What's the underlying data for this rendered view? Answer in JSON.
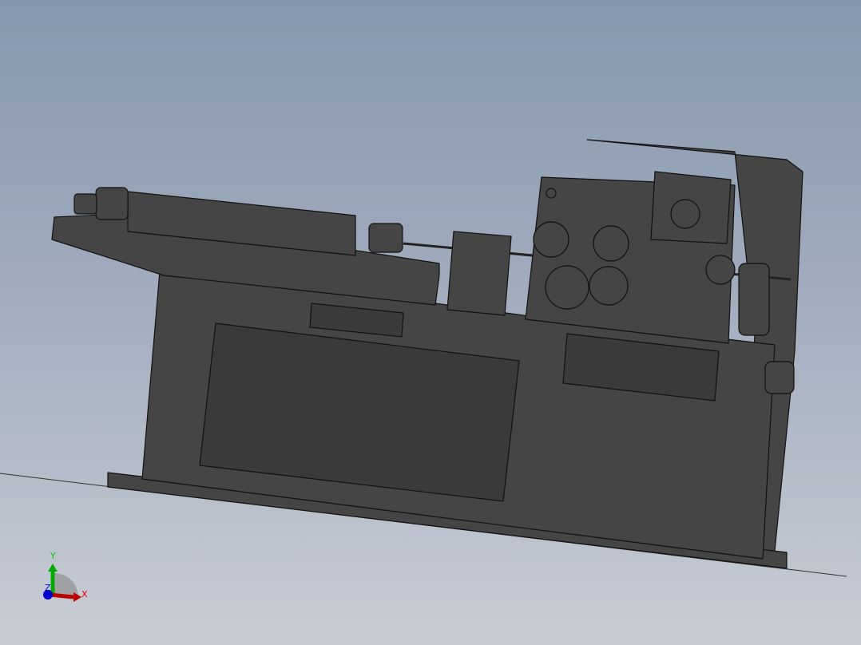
{
  "viewport": {
    "title": "",
    "background_top": "#8697ad",
    "background_bottom": "#c9cdd5",
    "model_color": "#454545"
  },
  "triad": {
    "x_label": "X",
    "y_label": "Y",
    "z_label": "Z",
    "x_color": "#cc0000",
    "y_color": "#00aa00",
    "z_color": "#0000cc"
  }
}
